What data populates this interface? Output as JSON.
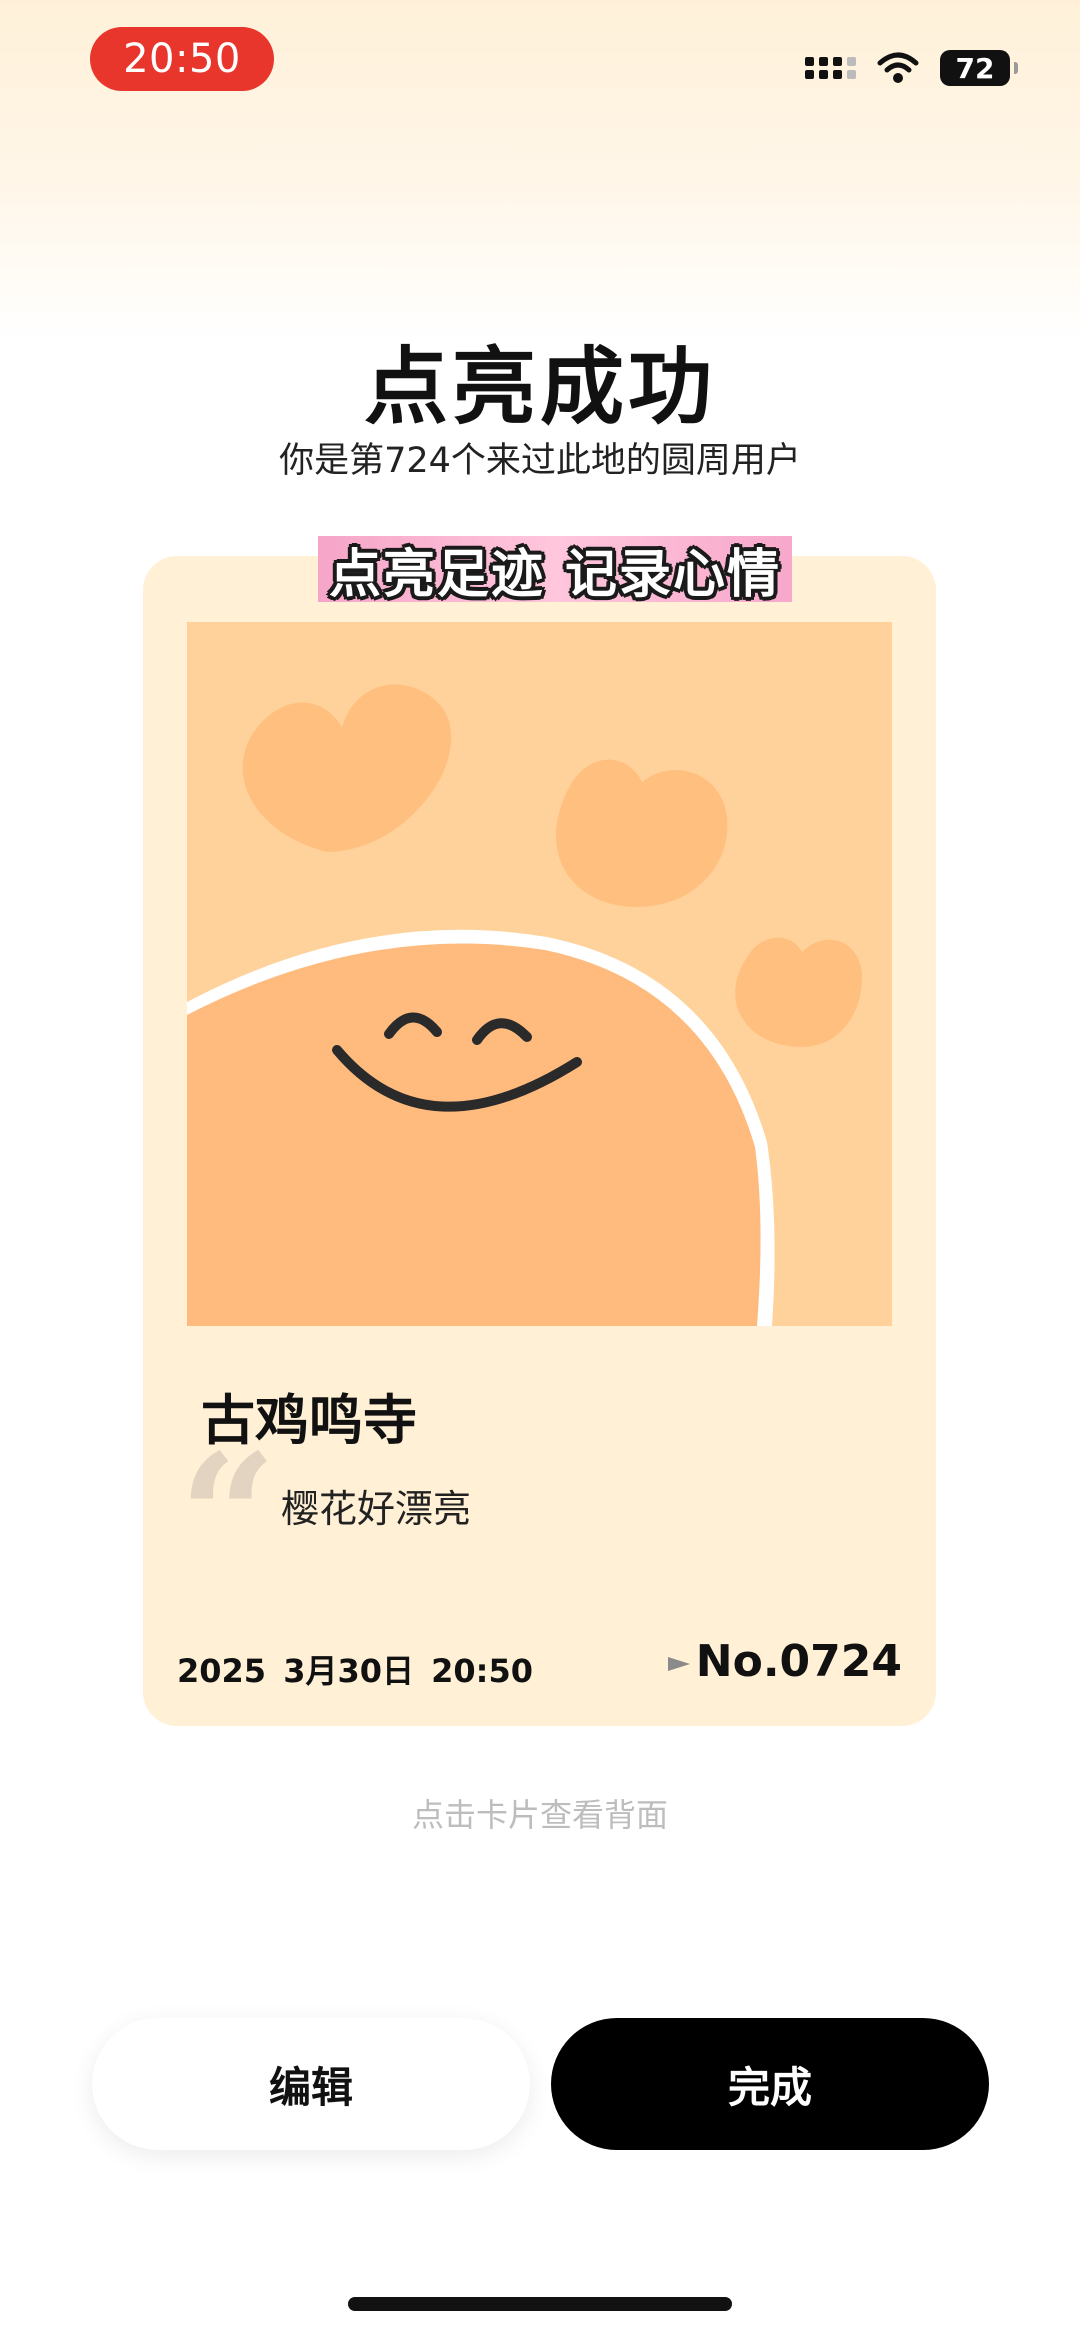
{
  "status_bar": {
    "time": "20:50",
    "battery": "72"
  },
  "header": {
    "title": "点亮成功",
    "subtitle": "你是第724个来过此地的圆周用户"
  },
  "card": {
    "banner": "点亮足迹 记录心情",
    "place": "古鸡鸣寺",
    "note": "樱花好漂亮",
    "date": "2025  3月30日 20:50",
    "number": "No.0724",
    "image_colors": {
      "background": "#ffd29c",
      "sun": "#ffbb7e",
      "hearts": "#ffc07f"
    }
  },
  "hint": "点击卡片查看背面",
  "buttons": {
    "edit": "编辑",
    "done": "完成"
  }
}
